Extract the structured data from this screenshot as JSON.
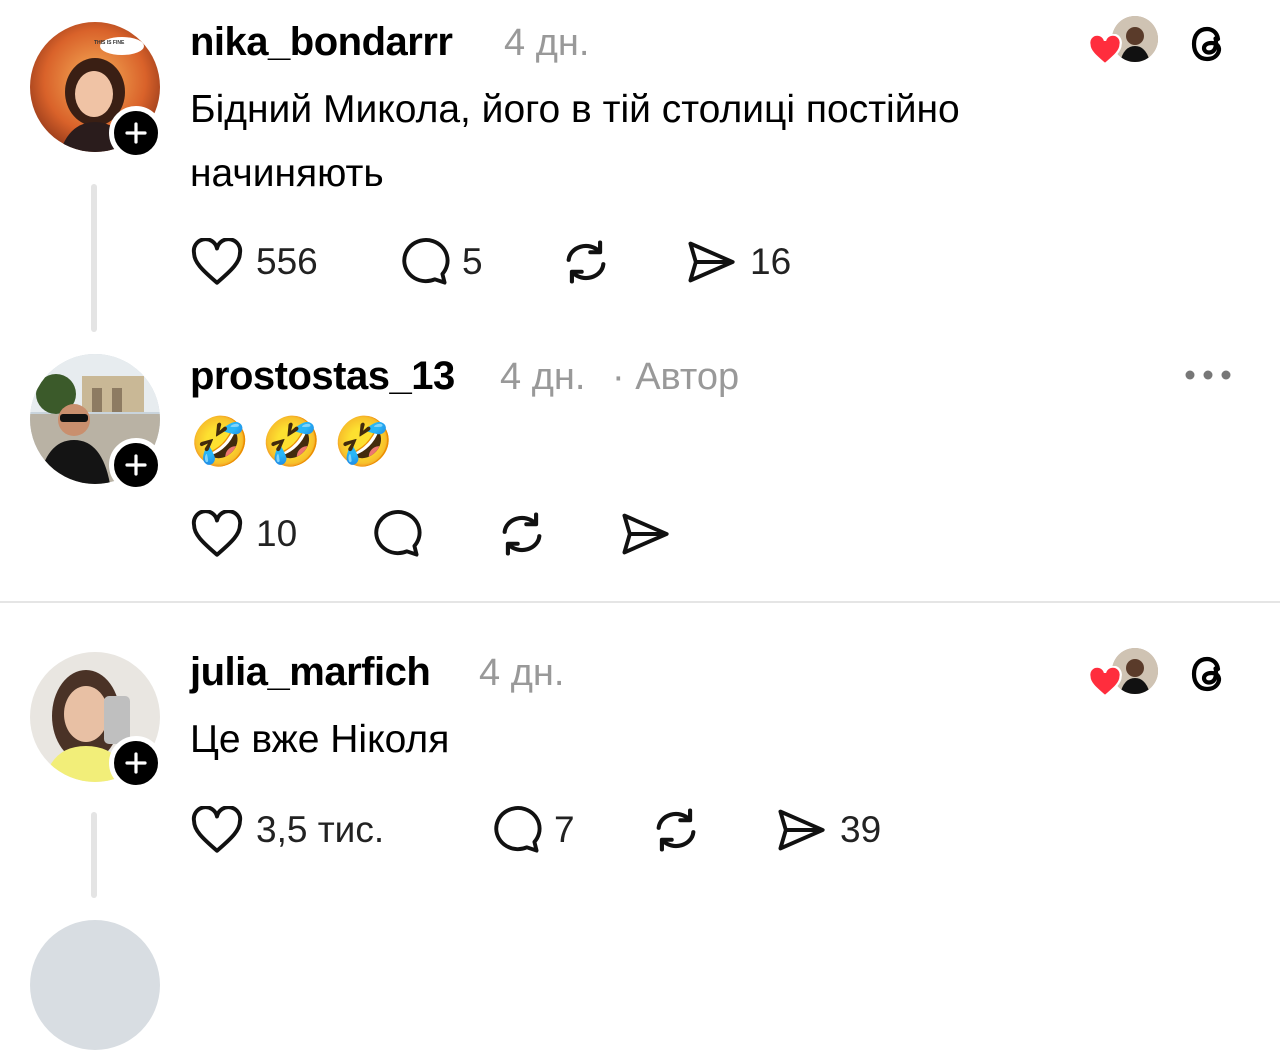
{
  "comments": [
    {
      "username": "nika_bondarrr",
      "time": "4 дн.",
      "author_tag": "",
      "avatar_text": "THIS IS FINE",
      "text": "Бідний Микола, його в тій столиці постійно начиняють",
      "likes": "556",
      "replies": "5",
      "shares": "16"
    },
    {
      "username": "prostostas_13",
      "time": "4 дн.",
      "author_tag": "· Автор",
      "emoji": [
        "🤣",
        "🤣",
        "🤣"
      ],
      "likes": "10"
    },
    {
      "username": "julia_marfich",
      "time": "4 дн.",
      "text": "Це вже Ніколя",
      "likes": "3,5 тис.",
      "replies": "7",
      "shares": "39"
    }
  ],
  "icons": {
    "like": "heart-outline-icon",
    "reply": "speech-bubble-icon",
    "repost": "repost-arrows-icon",
    "share": "paper-plane-icon",
    "threads": "threads-logo-icon",
    "more": "more-dots-icon",
    "liked_by_author": "red-heart-icon"
  },
  "colors": {
    "text": "#000000",
    "muted": "#999999",
    "heart": "#ff2d3d",
    "thread_line": "#e4e4e4"
  }
}
